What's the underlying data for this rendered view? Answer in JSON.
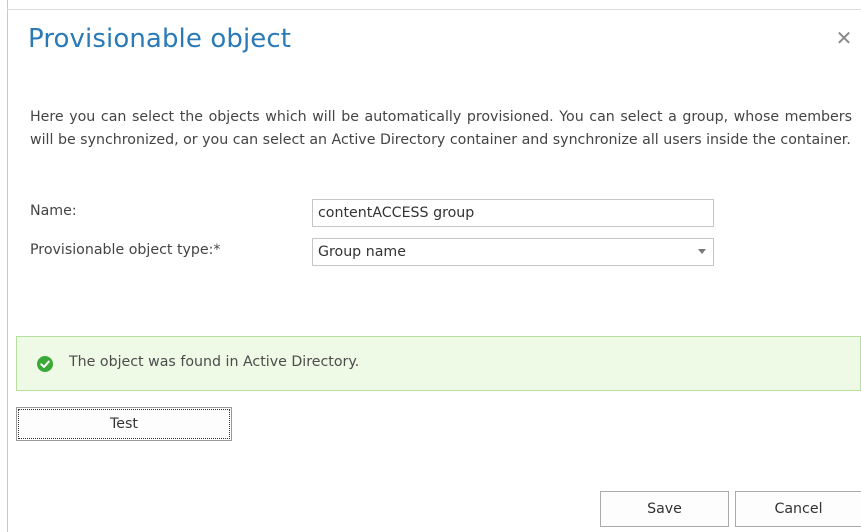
{
  "dialog": {
    "title": "Provisionable object",
    "close_glyph": "✕",
    "description": "Here you can select the objects which will be automatically provisioned. You can select a group, whose members will be synchronized, or you can select an Active Directory container and synchronize all users inside the container."
  },
  "form": {
    "name_label": "Name:",
    "name_value": "contentACCESS group",
    "type_label": "Provisionable object type:*",
    "type_value": "Group name"
  },
  "status": {
    "message": "The object was found in Active Directory.",
    "icon": "check-circle-icon",
    "color": "#3aa935"
  },
  "buttons": {
    "test": "Test",
    "save": "Save",
    "cancel": "Cancel"
  },
  "colors": {
    "title": "#2a7ab8",
    "success_background": "#eef9e6",
    "success_border": "#b6dfa0"
  }
}
